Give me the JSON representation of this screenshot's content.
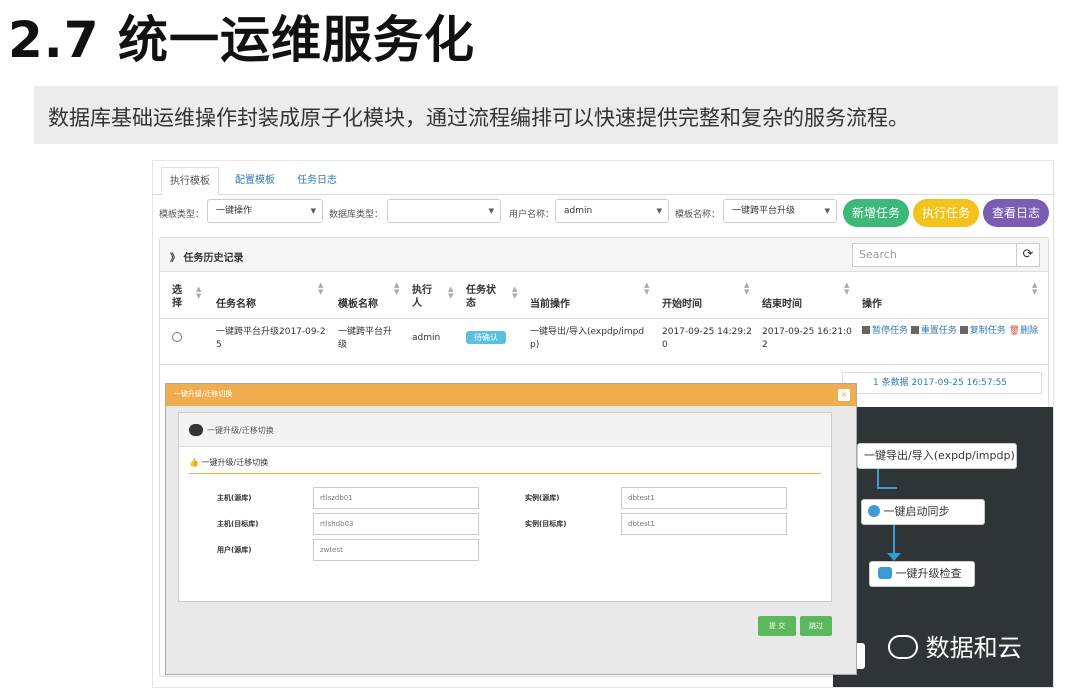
{
  "slide": {
    "title": "2.7 统一运维服务化",
    "subtitle": "数据库基础运维操作封装成原子化模块，通过流程编排可以快速提供完整和复杂的服务流程。"
  },
  "tabs": [
    "执行模板",
    "配置模板",
    "任务日志"
  ],
  "filters": {
    "template_type_label": "模板类型：",
    "template_type_value": "一键操作",
    "db_type_label": "数据库类型：",
    "db_type_value": "",
    "user_label": "用户名称：",
    "user_value": "admin",
    "template_name_label": "模板名称：",
    "template_name_value": "一键跨平台升级"
  },
  "buttons": {
    "new_task": "新增任务",
    "run_task": "执行任务",
    "view_log": "查看日志"
  },
  "colors": {
    "new_task": "#3cb878",
    "run_task": "#f4c21d",
    "view_log": "#7a5cb3",
    "modal_header": "#f0ad4e",
    "status_badge": "#5bc0de",
    "dark_bg": "#2f3437"
  },
  "panel": {
    "title": "》 任务历史记录",
    "search_placeholder": "Search",
    "refresh_icon": "refresh-icon"
  },
  "table": {
    "headers": {
      "select": "选\n择",
      "task_name": "任务名称",
      "template_name": "模板名称",
      "executor": "执行\n人",
      "status": "任务状\n态",
      "current_op": "当前操作",
      "start_time": "开始时间",
      "end_time": "结束时间",
      "actions": "操作"
    },
    "rows": [
      {
        "task_name": "一键跨平台升级2017-09-2\n5",
        "template_name": "一键跨平台升\n级",
        "executor": "admin",
        "status": "待确认",
        "current_op": "一键导出/导入(expdp/impd\np)",
        "start_time": "2017-09-25 14:29:2\n0",
        "end_time": "2017-09-25 16:21:0\n2",
        "actions": [
          "暂停任务",
          "重置任务",
          "复制任务",
          "删除"
        ]
      }
    ],
    "footer": "1 条数据  2017-09-25 16:57:55"
  },
  "flow": {
    "step1": "一键导出/导入(expdp/impdp)",
    "step2": "一键启动同步",
    "step3": "一键升级检查"
  },
  "modal": {
    "title": "一键升级/迁移切换",
    "inner_title": "一键升级/迁移切换",
    "section_title": "一键升级/迁移切换",
    "fields": {
      "source_host_label": "主机(源库)",
      "source_host_value": "rtlszdb01",
      "target_host_label": "主机(目标库)",
      "target_host_value": "rtlshdb03",
      "source_user_label": "用户(源库)",
      "source_user_value": "zwtest",
      "source_instance_label": "实例(源库)",
      "source_instance_value": "dbtest1",
      "target_instance_label": "实例(目标库)",
      "target_instance_value": "dbtest1"
    },
    "submit": "提 交",
    "skip": "跳过"
  },
  "watermark": "数据和云"
}
